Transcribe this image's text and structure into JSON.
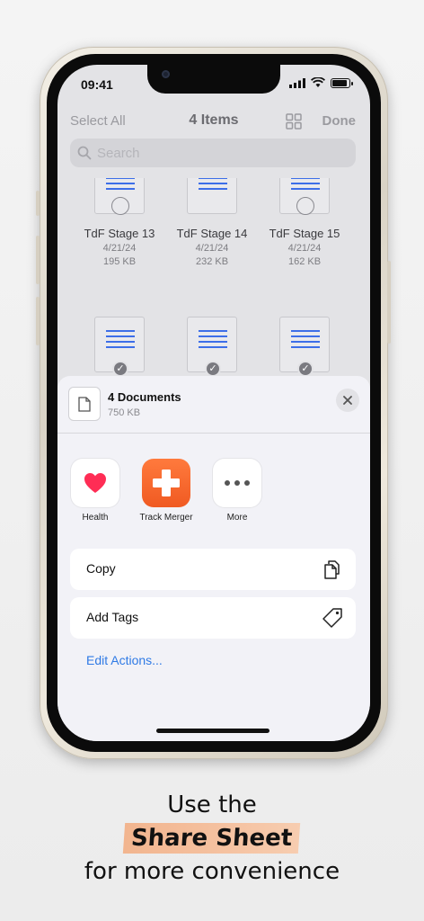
{
  "status_bar": {
    "time": "09:41",
    "battery_level": 0.9
  },
  "nav": {
    "left": "Select All",
    "title": "4 Items",
    "right": "Done",
    "grid_icon": "grid-icon"
  },
  "search": {
    "placeholder": "Search",
    "icon": "magnifier-icon"
  },
  "files": [
    {
      "name": "TdF Stage 13",
      "date": "4/21/24",
      "size": "195 KB"
    },
    {
      "name": "TdF Stage 14",
      "date": "4/21/24",
      "size": "232 KB"
    },
    {
      "name": "TdF Stage 15",
      "date": "4/21/24",
      "size": "162 KB"
    }
  ],
  "sheet": {
    "title": "4 Documents",
    "subtitle": "750 KB",
    "apps": [
      {
        "label": "Health",
        "icon": "heart-icon"
      },
      {
        "label": "Track Merger",
        "icon": "plus-cross-icon"
      },
      {
        "label": "More",
        "icon": "ellipsis-icon"
      }
    ],
    "actions": [
      {
        "label": "Copy",
        "icon": "copy-icon"
      },
      {
        "label": "Add Tags",
        "icon": "tag-icon"
      }
    ],
    "edit_actions": "Edit Actions..."
  },
  "caption": {
    "line1": "Use the",
    "line2": "Share Sheet",
    "line3": "for more convenience"
  },
  "colors": {
    "accent_blue": "#2f7ae5",
    "doc_lines": "#3d6ee8",
    "track_orange": "#f05a22",
    "health_heart": "#ff2d55",
    "highlight": "#f2b58f"
  }
}
